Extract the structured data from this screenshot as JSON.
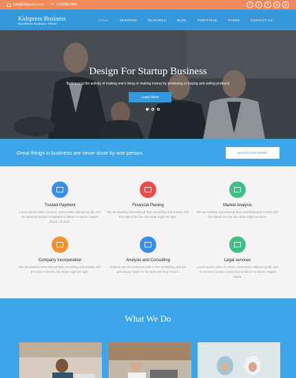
{
  "topbar": {
    "email": "info@kidspress.com",
    "phone": "+1234567890",
    "social_icons": [
      "facebook-icon",
      "pinterest-icon",
      "twitter-icon",
      "google-plus-icon",
      "instagram-icon"
    ]
  },
  "header": {
    "site_title": "Kidspress Business",
    "tagline": "WordPress Business Theme",
    "nav": [
      "Home",
      "Services",
      "Features",
      "Blog",
      "Portfolio",
      "Pages",
      "Contact Us"
    ]
  },
  "hero": {
    "title": "Design For Startup Business",
    "subtitle": "Business is the activity of making one's living or making money by producing or buying and selling products",
    "button": "Learn More"
  },
  "cta": {
    "text": "Great things in business are never done by one person.",
    "button": "Watch Our Story"
  },
  "services": [
    {
      "title": "Trusted Payment",
      "desc": "Lorem ipsum dolor sit amet, consectetur adipiscing elit, sed do eiusmod tempor incididunt ut labore et dolore magna aliqua. Ut enim.",
      "color": "#3b8ee8",
      "icon": "card-icon"
    },
    {
      "title": "Financial Planing",
      "desc": "We are leading international that consulting and trouble with the lowest fee the day what might be right.",
      "color": "#e94b4b",
      "icon": "chart-icon"
    },
    {
      "title": "Market Analysis",
      "desc": "We are leading international that consulting and trouble with the lowest fee the day what might be more.",
      "color": "#3fbf8a",
      "icon": "analytics-icon"
    },
    {
      "title": "Company Incorporation",
      "desc": "We are leading international that consulting and trouble with the lowest fee the day what might be right.",
      "color": "#f0922f",
      "icon": "handshake-icon"
    },
    {
      "title": "Analysis and Consulting",
      "desc": "Nobody can be reasoned with in this consulting and are absolutely better on the business they trust it.",
      "color": "#3b8ee8",
      "icon": "gears-icon"
    },
    {
      "title": "Legal services",
      "desc": "Lorem ipsum dolor sit amet, consectetur adipiscing elit, sed do eiusmod tempor incididunt ut labore et dolore magna aliqua.",
      "color": "#3fbf8a",
      "icon": "bank-icon"
    }
  ],
  "what": {
    "title": "What We Do"
  },
  "colors": {
    "topbar": "#f08a5d",
    "primary": "#3498db",
    "section_bg": "#f6f4f4"
  }
}
